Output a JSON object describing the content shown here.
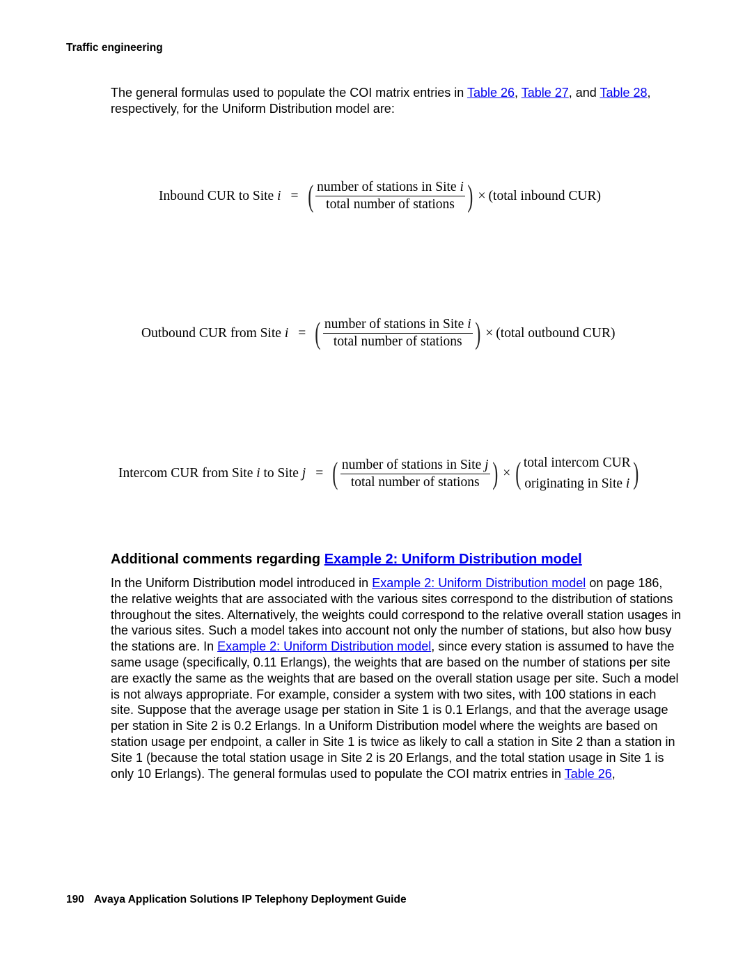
{
  "header": {
    "running_title": "Traffic engineering"
  },
  "intro": {
    "text_1": "The general formulas used to populate the COI matrix entries in ",
    "link_1": "Table 26",
    "sep_1": ", ",
    "link_2": "Table 27",
    "text_2": ", and ",
    "link_3": "Table 28",
    "text_3": ", respectively, for the Uniform Distribution model are:"
  },
  "formulas": {
    "inbound": {
      "lhs": "Inbound CUR to Site ",
      "lhs_var": "i",
      "eq": "=",
      "numerator": "number of stations in Site ",
      "numerator_var": "i",
      "denominator": "total number of stations",
      "times": "×",
      "rhs": "(total inbound CUR)"
    },
    "outbound": {
      "lhs": "Outbound CUR from Site ",
      "lhs_var": "i",
      "eq": "=",
      "numerator": "number of stations in Site ",
      "numerator_var": "i",
      "denominator": "total number of stations",
      "times": "×",
      "rhs": "(total outbound CUR)"
    },
    "intercom": {
      "lhs_1": "Intercom CUR from Site ",
      "lhs_var_1": "i",
      "lhs_2": " to Site ",
      "lhs_var_2": "j",
      "eq": "=",
      "numerator": "number of stations in Site ",
      "numerator_var": "j",
      "denominator": "total number of stations",
      "times": "×",
      "rhs_top": "total intercom CUR",
      "rhs_bottom": "originating in Site ",
      "rhs_bottom_var": "i"
    }
  },
  "section": {
    "heading_text": "Additional comments regarding ",
    "heading_link": "Example 2: Uniform Distribution model",
    "p_1": "In the Uniform Distribution model introduced in ",
    "p_link_1": "Example 2: Uniform Distribution model",
    "p_2": " on page 186, the relative weights that are associated with the various sites correspond to the distribution of stations throughout the sites. Alternatively, the weights could correspond to the relative overall station usages in the various sites. Such a model takes into account not only the number of stations, but also how busy the stations are. In ",
    "p_link_2": "Example 2: Uniform Distribution model",
    "p_3": ", since every station is assumed to have the same usage (specifically, 0.11 Erlangs), the weights that are based on the number of stations per site are exactly the same as the weights that are based on the overall station usage per site. Such a model is not always appropriate. For example, consider a system with two sites, with 100 stations in each site. Suppose that the average usage per station in Site 1 is 0.1 Erlangs, and that the average usage per station in Site 2 is 0.2 Erlangs. In a Uniform Distribution model where the weights are based on station usage per endpoint, a caller in Site 1 is twice as likely to call a station in Site 2 than a station in Site 1 (because the total station usage in Site 2 is 20 Erlangs, and the total station usage in Site 1 is only 10 Erlangs). The general formulas used to populate the COI matrix entries in ",
    "p_link_3": "Table 26",
    "p_4": ","
  },
  "footer": {
    "page_number": "190",
    "doc_title": "Avaya Application Solutions IP Telephony Deployment Guide"
  }
}
